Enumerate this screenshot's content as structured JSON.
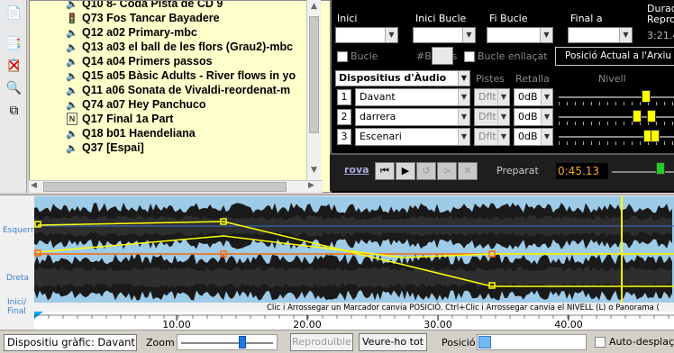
{
  "cue_list": {
    "items": [
      {
        "label": "Q10 8- Coda Pista de CD 9",
        "icon": "speaker-icon"
      },
      {
        "label": "Q73 Fos Tancar Bayadere",
        "icon": "traffic-light-icon"
      },
      {
        "label": "Q12 a02 Primary-mbc",
        "icon": "speaker-icon"
      },
      {
        "label": "Q13 a03 el ball de les flors (Grau2)-mbc",
        "icon": "speaker-icon"
      },
      {
        "label": "Q14 a04 Primers passos",
        "icon": "speaker-icon"
      },
      {
        "label": "Q15 a05 Bàsic Adults - River flows in yo",
        "icon": "speaker-icon"
      },
      {
        "label": "Q11 a06 Sonata de Vivaldi-reordenat-m",
        "icon": "speaker-icon"
      },
      {
        "label": "Q74 a07 Hey Panchuco",
        "icon": "speaker-icon"
      },
      {
        "label": "Q17 Final 1a Part",
        "icon": "note-n-icon"
      },
      {
        "label": "Q18 b01 Haendeliana",
        "icon": "speaker-icon"
      },
      {
        "label": "Q37 [Espai]",
        "icon": "speaker-icon"
      }
    ]
  },
  "panel": {
    "inici": "Inici",
    "inici_bucle": "Inici Bucle",
    "fi_bucle": "Fi Bucle",
    "final_a": "Final a",
    "durada": "Durad",
    "reprod": "Reprod",
    "duration_value": "3:21.4",
    "bucle": "Bucle",
    "num_bucles": "#Bucles",
    "bucle_enllacat": "Bucle enllaçat",
    "posicio_button": "Posició Actual a l'Arxiu"
  },
  "devices": {
    "header": "Dispositius d'Àudio",
    "pistes": "Pistes",
    "retalla": "Retalla",
    "nivell": "Nivell",
    "rows": [
      {
        "num": "1",
        "name": "Davant",
        "pistes": "Dflt",
        "retalla": "0dB"
      },
      {
        "num": "2",
        "name": "darrera",
        "pistes": "Dflt",
        "retalla": "0dB"
      },
      {
        "num": "3",
        "name": "Escenari",
        "pistes": "Dflt",
        "retalla": "0dB"
      }
    ]
  },
  "transport": {
    "prova": "rova",
    "preparat": "Preparat",
    "time": "0:45.13"
  },
  "waveform": {
    "esquerra": "Esquerra",
    "dreta": "Dreta",
    "inici_final": "Inici/\nFinal",
    "hint": "Clic i Arrossegar un Marcador canvia POSICIÓ. Ctrl+Clic i Arrossegar canvia el NIVELL (L) o Panorama (",
    "ruler": [
      "10.00",
      "20.00",
      "30.00",
      "40.00"
    ]
  },
  "bottom": {
    "device_label": "Dispositiu gràfic: Davant",
    "zoom": "Zoom",
    "reproduible": "Reproduïble",
    "veure_tot": "Veure-ho tot",
    "posicio": "Posició",
    "auto_desplacament": "Auto-desplaçar"
  },
  "colors": {
    "cue_bg": "#ffffcc",
    "panel_bg": "#000000",
    "wave_bg": "#9dcbe8",
    "envelope": "#ffff00",
    "time_text": "#f5a623"
  }
}
